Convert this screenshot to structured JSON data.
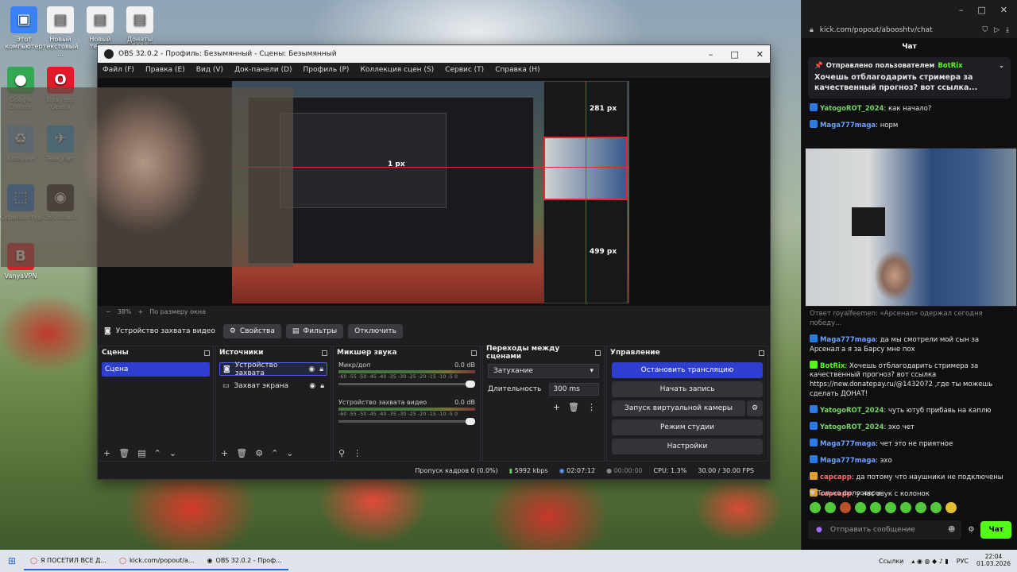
{
  "desktop": {
    "icons": [
      {
        "label": "Этот компьютер",
        "glyph": "▣",
        "color": "#3b82f6"
      },
      {
        "label": "Новый текстовый ...",
        "glyph": "▤",
        "color": "#f1f1f1"
      },
      {
        "label": "Новый текс...",
        "glyph": "▤",
        "color": "#f1f1f1"
      },
      {
        "label": "Донаты 2026",
        "glyph": "▤",
        "color": "#f1f1f1"
      },
      {
        "label": "Google Chrome",
        "glyph": "●",
        "color": "#34a853"
      },
      {
        "label": "Браузер Opera",
        "glyph": "O",
        "color": "#e21b2b"
      },
      {
        "label": "Корзина",
        "glyph": "♻",
        "color": "#6aa5d8"
      },
      {
        "label": "Telegram",
        "glyph": "✈",
        "color": "#2aa3e0"
      },
      {
        "label": "Скриншотер",
        "glyph": "⬚",
        "color": "#1d7be0"
      },
      {
        "label": "OBS Studio",
        "glyph": "◉",
        "color": "#222"
      },
      {
        "label": "VanyaVPN",
        "glyph": "B",
        "color": "#e11d2a"
      }
    ]
  },
  "obs": {
    "title": "OBS 32.0.2 - Профиль: Безымянный - Сцены: Безымянный",
    "menu": [
      "Файл (F)",
      "Правка (E)",
      "Вид (V)",
      "Док-панели (D)",
      "Профиль (P)",
      "Коллекция сцен (S)",
      "Сервис (T)",
      "Справка (H)"
    ],
    "preview": {
      "overlay_px_top": "281 px",
      "overlay_px_left": "1 px",
      "overlay_px_bottom": "499 px"
    },
    "zoom": {
      "minus": "−",
      "value": "38%",
      "plus": "+",
      "fit_label": "По размеру окна"
    },
    "source_toolbar": {
      "source_name": "Устройство захвата видео",
      "properties": "Свойства",
      "filters": "Фильтры",
      "deactivate": "Отключить"
    },
    "scenes": {
      "title": "Сцены",
      "items": [
        "Сцена"
      ]
    },
    "sources": {
      "title": "Источники",
      "items": [
        "Устройство захвата",
        "Захват экрана"
      ]
    },
    "mixer": {
      "title": "Микшер звука",
      "scale": "-60 -55 -50 -45 -40 -35 -30 -25 -20 -15 -10 -5 0",
      "tracks": [
        {
          "name": "Микр/доп",
          "level": "0.0 dB"
        },
        {
          "name": "Устройство захвата видео",
          "level": "0.0 dB"
        }
      ]
    },
    "transitions": {
      "title": "Переходы между сценами",
      "selected": "Затухание",
      "duration_label": "Длительность",
      "duration_value": "300 ms"
    },
    "controls": {
      "title": "Управление",
      "stop_stream": "Остановить трансляцию",
      "start_record": "Начать запись",
      "virtual_cam": "Запуск виртуальной камеры",
      "studio_mode": "Режим студии",
      "settings": "Настройки"
    },
    "status": {
      "dropped": "Пропуск кадров 0 (0.0%)",
      "bitrate": "5992 kbps",
      "stream_time": "02:07:12",
      "record_time": "00:00:00",
      "cpu": "CPU: 1.3%",
      "fps": "30.00 / 30.00 FPS"
    }
  },
  "chat": {
    "url": "kick.com/popout/abooshtv/chat",
    "title": "Чат",
    "pinned": {
      "sent_by": "Отправлено пользователем",
      "user": "BotRix",
      "text": "Хочешь отблагодарить стримера за качественный прогноз? вот ссылка..."
    },
    "messages_top": [
      {
        "user": "YatogoROT_2024",
        "color": "u-green",
        "text": "как начало?"
      },
      {
        "user": "Maga777maga",
        "color": "u-blue",
        "text": "норм"
      }
    ],
    "messages": [
      {
        "user": "",
        "color": "u-green",
        "text": "Ответ royalfeemen: «Арсенал» одержал сегодня победу..."
      },
      {
        "user": "Maga777maga",
        "color": "u-blue",
        "text": "да мы смотрели мой сын за Арсенал а я за Барсу мне пох"
      },
      {
        "user": "BotRix",
        "color": "u-bot",
        "text": "Хочешь отблагодарить стримера за качественный прогноз? вот ссылка https://new.donatepay.ru/@1432072 ,где ты можешь сделать ДОНАТ!"
      },
      {
        "user": "YatogoROT_2024",
        "color": "u-green",
        "text": "чуть ютуб прибавь на каплю"
      },
      {
        "user": "YatogoROT_2024",
        "color": "u-green",
        "text": "эхо чет"
      },
      {
        "user": "Maga777maga",
        "color": "u-blue",
        "text": "чет это не приятное"
      },
      {
        "user": "Maga777maga",
        "color": "u-blue",
        "text": "эхо"
      },
      {
        "user": "сарсарр",
        "color": "u-red",
        "text": "да потому что наушники не подключены"
      },
      {
        "user": "сарсарр",
        "color": "u-red",
        "text": "у нас звук с колонок"
      }
    ],
    "followers_only": "Только фолловеры",
    "input_placeholder": "Отправить сообщение",
    "send_label": "Чат"
  },
  "taskbar": {
    "apps": [
      {
        "label": "Я ПОСЕТИЛ ВСЕ Д..."
      },
      {
        "label": "kick.com/popout/a..."
      },
      {
        "label": "OBS 32.0.2 - Проф..."
      }
    ],
    "links_label": "Ссылки",
    "lang": "РУС",
    "time": "22:04",
    "date": "01.03.2026"
  }
}
